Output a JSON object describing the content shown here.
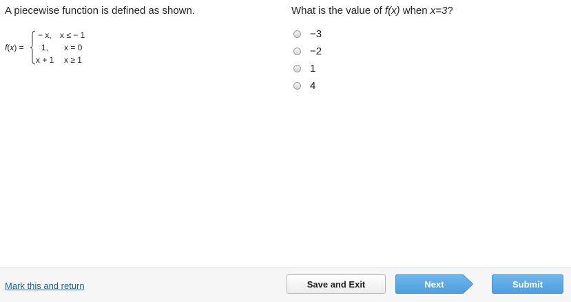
{
  "problem": {
    "statement": "A piecewise function is defined as shown.",
    "function_lhs": "f(x) =",
    "cases": [
      {
        "expr": "− x,",
        "cond": "x ≤ − 1"
      },
      {
        "expr": "1,",
        "cond": "x = 0"
      },
      {
        "expr": "x + 1",
        "cond": "x ≥ 1"
      }
    ]
  },
  "question": {
    "text_prefix": "What is the value of ",
    "text_func": "f(x)",
    "text_mid": " when ",
    "text_var": "x=3",
    "text_suffix": "?",
    "options": [
      "−3",
      "−2",
      "1",
      "4"
    ]
  },
  "footer": {
    "mark_link": "Mark this and return",
    "save_label": "Save and Exit",
    "next_label": "Next",
    "submit_label": "Submit"
  },
  "colors": {
    "link": "#1a6496",
    "primary_button": "#5aa7e4"
  }
}
